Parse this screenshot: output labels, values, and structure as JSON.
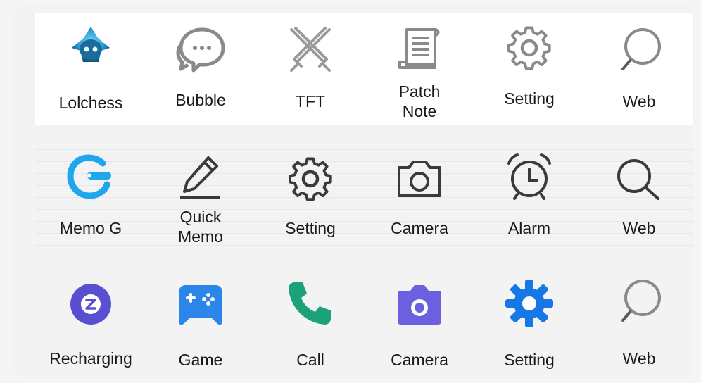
{
  "rows": [
    {
      "name": "theme-row-1",
      "items": [
        {
          "label": "Lolchess",
          "icon": "lolchess-creature-icon"
        },
        {
          "label": "Bubble",
          "icon": "chat-bubble-icon"
        },
        {
          "label": "TFT",
          "icon": "crossed-swords-icon"
        },
        {
          "label": "Patch Note",
          "icon": "scroll-note-icon"
        },
        {
          "label": "Setting",
          "icon": "gear-outline-icon"
        },
        {
          "label": "Web",
          "icon": "search-outline-icon"
        }
      ]
    },
    {
      "name": "theme-row-2",
      "items": [
        {
          "label": "Memo G",
          "icon": "memo-g-icon"
        },
        {
          "label": "Quick Memo",
          "icon": "pencil-icon"
        },
        {
          "label": "Setting",
          "icon": "gear-outline-icon"
        },
        {
          "label": "Camera",
          "icon": "camera-outline-icon"
        },
        {
          "label": "Alarm",
          "icon": "alarm-clock-icon"
        },
        {
          "label": "Web",
          "icon": "search-outline-icon"
        }
      ]
    },
    {
      "name": "theme-row-3",
      "items": [
        {
          "label": "Recharging",
          "icon": "recharging-z-icon"
        },
        {
          "label": "Game",
          "icon": "gamepad-icon"
        },
        {
          "label": "Call",
          "icon": "phone-icon"
        },
        {
          "label": "Camera",
          "icon": "camera-filled-icon"
        },
        {
          "label": "Setting",
          "icon": "gear-filled-icon"
        },
        {
          "label": "Web",
          "icon": "search-outline-icon"
        }
      ]
    }
  ],
  "colors": {
    "memo_g": "#1fa7ee",
    "recharging": "#5a4fd1",
    "game": "#2a86e8",
    "call": "#1aa37a",
    "camera_filled": "#6a60e0",
    "gear_filled": "#1677e5",
    "outline_gray": "#8a8a8a",
    "outline_dark": "#3a3a3a"
  }
}
